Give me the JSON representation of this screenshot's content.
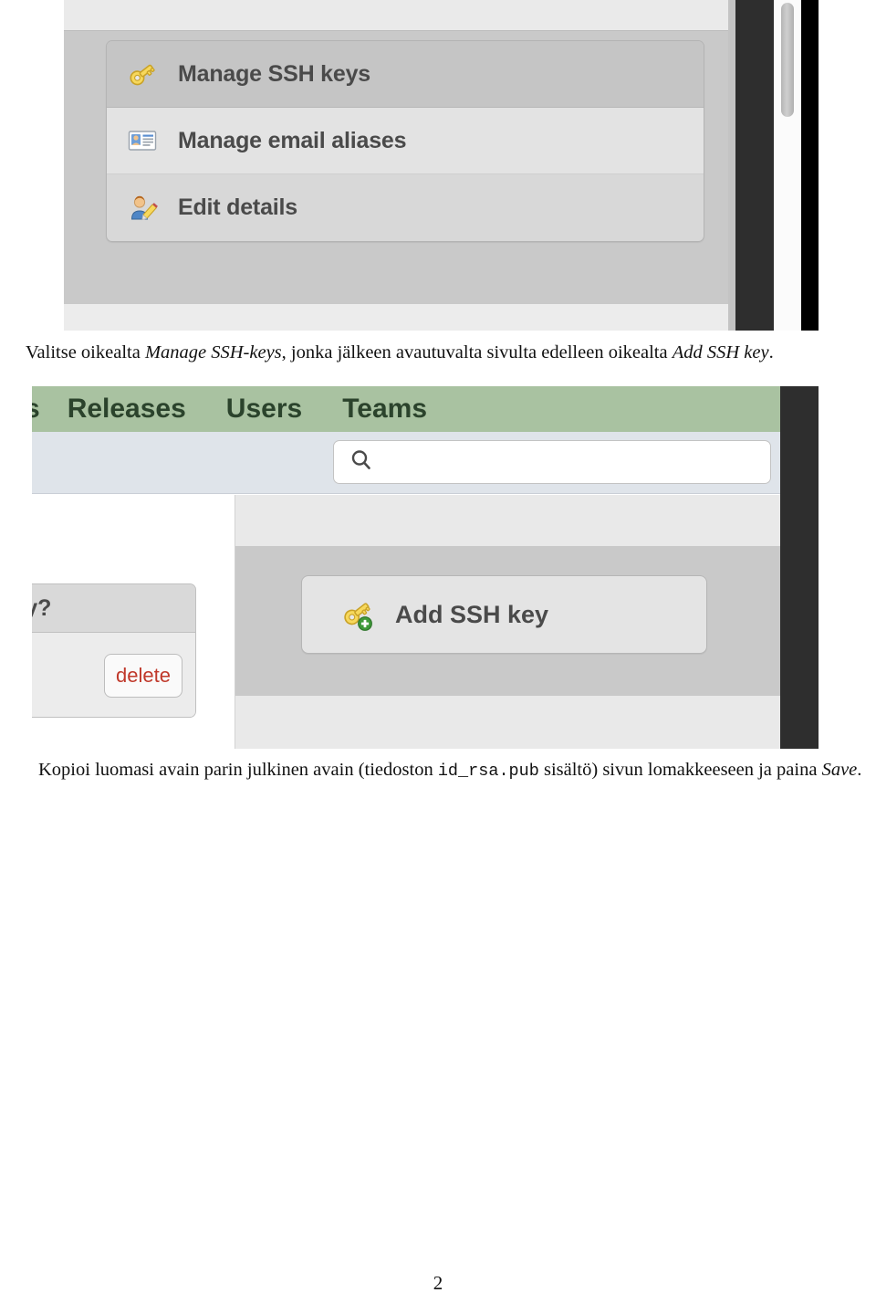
{
  "document": {
    "page_number": "2"
  },
  "screenshot1": {
    "name": "profile-actions-menu",
    "menu_items": [
      {
        "label": "Manage SSH keys",
        "icon": "key-icon"
      },
      {
        "label": "Manage email aliases",
        "icon": "contact-card-icon"
      },
      {
        "label": "Edit details",
        "icon": "user-edit-icon"
      }
    ]
  },
  "caption1": {
    "part1": "Valitse oikealta ",
    "em1": "Manage SSH-keys",
    "part2": ", jonka jälkeen avautuvalta sivulta edelleen oikealta ",
    "em2": "Add SSH key",
    "part3": "."
  },
  "screenshot2": {
    "name": "ssh-keys-page",
    "nav": {
      "clipped_item": "s",
      "items": [
        "Releases",
        "Users",
        "Teams"
      ]
    },
    "search": {
      "icon": "search-icon",
      "value": "",
      "placeholder": ""
    },
    "left_panel": {
      "header_clipped": "dy?",
      "delete_label": "delete",
      "status_icon": "green-marker-icon"
    },
    "add_button": {
      "label": "Add SSH key",
      "icon": "key-add-icon"
    },
    "colors": {
      "nav_green": "#a9c2a1",
      "nav_text": "#2b432c",
      "search_band": "#dfe4ea",
      "delete_red": "#c0392b",
      "dark_bar": "#2e2e2e"
    }
  },
  "caption2": {
    "part1": "Kopioi luomasi avain parin julkinen avain (tiedoston ",
    "mono": "id_rsa.pub",
    "part2": " sisältö) sivun lomakkeeseen ja paina ",
    "em": "Save",
    "part3": "."
  }
}
